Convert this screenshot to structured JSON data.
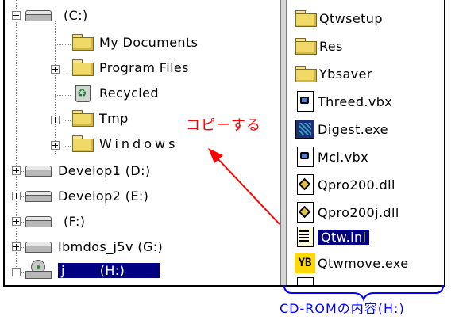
{
  "tree": {
    "items": [
      {
        "label": "(C:)",
        "icon": "hard-drive-icon"
      },
      {
        "label": "My Documents",
        "icon": "folder-icon"
      },
      {
        "label": "Program Files",
        "icon": "folder-icon"
      },
      {
        "label": "Recycled",
        "icon": "recycle-bin-icon"
      },
      {
        "label": "Tmp",
        "icon": "folder-icon"
      },
      {
        "label": "Windows",
        "icon": "folder-icon"
      },
      {
        "label": "Develop1 (D:)",
        "icon": "hard-drive-icon"
      },
      {
        "label": "Develop2 (E:)",
        "icon": "hard-drive-icon"
      },
      {
        "label": "(F:)",
        "icon": "hard-drive-icon"
      },
      {
        "label": "Ibmdos_j5v (G:)",
        "icon": "hard-drive-icon"
      },
      {
        "label": "j        (H:)",
        "icon": "cd-rom-drive-icon",
        "selected": true
      }
    ]
  },
  "files": {
    "items": [
      {
        "label": "Qtwsetup",
        "icon": "folder-icon"
      },
      {
        "label": "Res",
        "icon": "folder-icon"
      },
      {
        "label": "Ybsaver",
        "icon": "folder-icon"
      },
      {
        "label": "Threed.vbx",
        "icon": "vbx-file-icon"
      },
      {
        "label": "Digest.exe",
        "icon": "exe-file-icon"
      },
      {
        "label": "Mci.vbx",
        "icon": "vbx-file-icon"
      },
      {
        "label": "Qpro200.dll",
        "icon": "dll-file-icon"
      },
      {
        "label": "Qpro200j.dll",
        "icon": "dll-file-icon"
      },
      {
        "label": "Qtw.ini",
        "icon": "ini-file-icon",
        "selected": true
      },
      {
        "label": "Qtwmove.exe",
        "icon": "yb-exe-icon"
      }
    ]
  },
  "annotation": {
    "text": "コピーする",
    "color": "#ff0000"
  },
  "caption": {
    "text": "CD-ROMの内容(H:)",
    "color": "#0000ff"
  },
  "colors": {
    "selection": "#000080",
    "annotation": "#ff0000",
    "caption": "#0000ff"
  }
}
